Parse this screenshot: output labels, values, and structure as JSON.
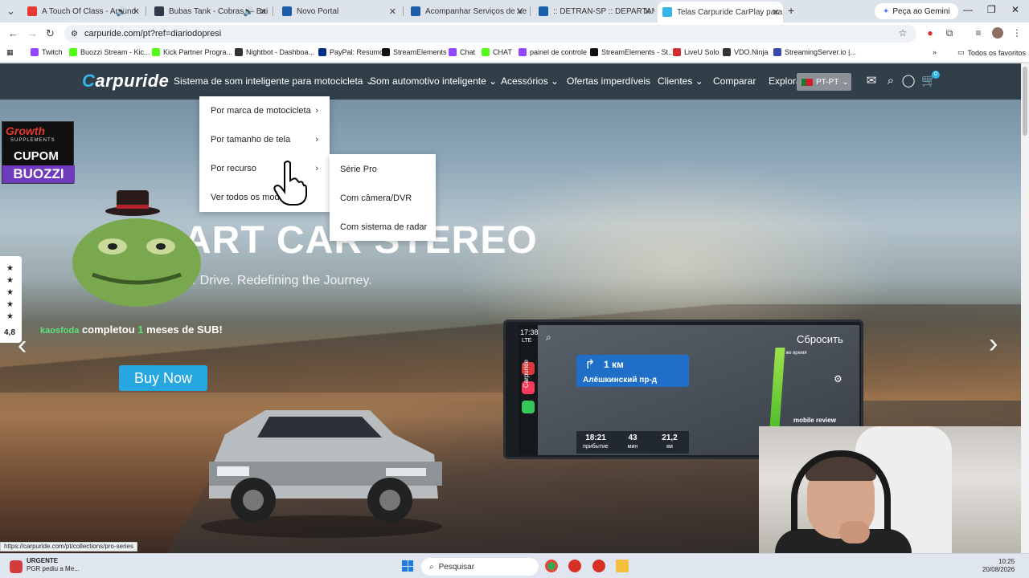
{
  "browser": {
    "tabs": [
      {
        "label": "A Touch Of Class - Around",
        "color": "#e53935"
      },
      {
        "label": "Bubas Tank - Cobras — Bai",
        "color": "#2f3b4b"
      },
      {
        "label": "Novo Portal",
        "color": "#1a5dab"
      },
      {
        "label": "Acompanhar Serviços de Veícu",
        "color": "#1a5dab"
      },
      {
        "label": ":: DETRAN-SP :: DEPARTAMENT",
        "color": "#1a5dab"
      },
      {
        "label": "Telas Carpuride CarPlay para M",
        "color": "#35b6e8"
      }
    ],
    "new_tab": "+",
    "gemini_label": "Peça ao Gemini",
    "url": "carpuride.com/pt?ref=diariodopresi",
    "bookmarks": [
      {
        "label": "Twitch",
        "color": "#9146ff"
      },
      {
        "label": "Buozzi Stream - Kic...",
        "color": "#53fc18"
      },
      {
        "label": "Kick Partner Progra...",
        "color": "#53fc18"
      },
      {
        "label": "Nightbot - Dashboa...",
        "color": "#333333"
      },
      {
        "label": "PayPal: Resumo",
        "color": "#003087"
      },
      {
        "label": "StreamElements",
        "color": "#111111"
      },
      {
        "label": "Chat",
        "color": "#9146ff"
      },
      {
        "label": "CHAT",
        "color": "#53fc18"
      },
      {
        "label": "painel de controle",
        "color": "#9146ff"
      },
      {
        "label": "StreamElements - St...",
        "color": "#111111"
      },
      {
        "label": "LiveU Solo",
        "color": "#d32f2f"
      },
      {
        "label": "VDO.Ninja",
        "color": "#333333"
      },
      {
        "label": "StreamingServer.io |...",
        "color": "#3949ab"
      }
    ],
    "all_bookmarks": "Todos os favoritos",
    "status_url": "https://carpuride.com/pt/collections/pro-series"
  },
  "site": {
    "logo_c": "C",
    "logo_rest": "arpuride",
    "nav": [
      "Sistema de som inteligente para motocicleta",
      "Som automotivo inteligente",
      "Acessórios",
      "Ofertas imperdíveis",
      "Clientes",
      "Comparar",
      "Explorar"
    ],
    "lang": "PT-PT",
    "cart_count": "0",
    "dropdown": [
      "Por marca de motocicleta",
      "Por tamanho de tela",
      "Por recurso",
      "Ver todos os modelos"
    ],
    "submenu": [
      "Série Pro",
      "Com câmera/DVR",
      "Com sistema de radar"
    ],
    "hero_title": "ART CAR STEREO",
    "hero_sub": "ar Drive. Redefining the Journey.",
    "buy_now": "Buy Now"
  },
  "overlays": {
    "promo": {
      "top": "Growth",
      "sub": "SUPPLEMENTS",
      "mid": "CUPOM",
      "bottom": "BUOZZI"
    },
    "rating": "4,8",
    "sub_notice": {
      "name": "kaosfoda",
      "text1": "completou",
      "num": "1",
      "text2": "meses de SUB!"
    }
  },
  "device": {
    "time": "17:38",
    "signal": "LTE",
    "distance": "1 км",
    "street": "Алёшкинский пр-д",
    "reset": "Сбросить",
    "eta": [
      {
        "value": "18:21",
        "label": "прибытие"
      },
      {
        "value": "43",
        "label": "мин"
      },
      {
        "value": "21,2",
        "label": "км"
      }
    ],
    "brand": "Carpuride",
    "mobile_review": "mobile review",
    "map_label": "То же время"
  },
  "taskbar": {
    "news_title": "URGENTE",
    "news_text": "PGR pediu a Me...",
    "search_placeholder": "Pesquisar",
    "time": "10:25",
    "date": "20/08/2026"
  }
}
